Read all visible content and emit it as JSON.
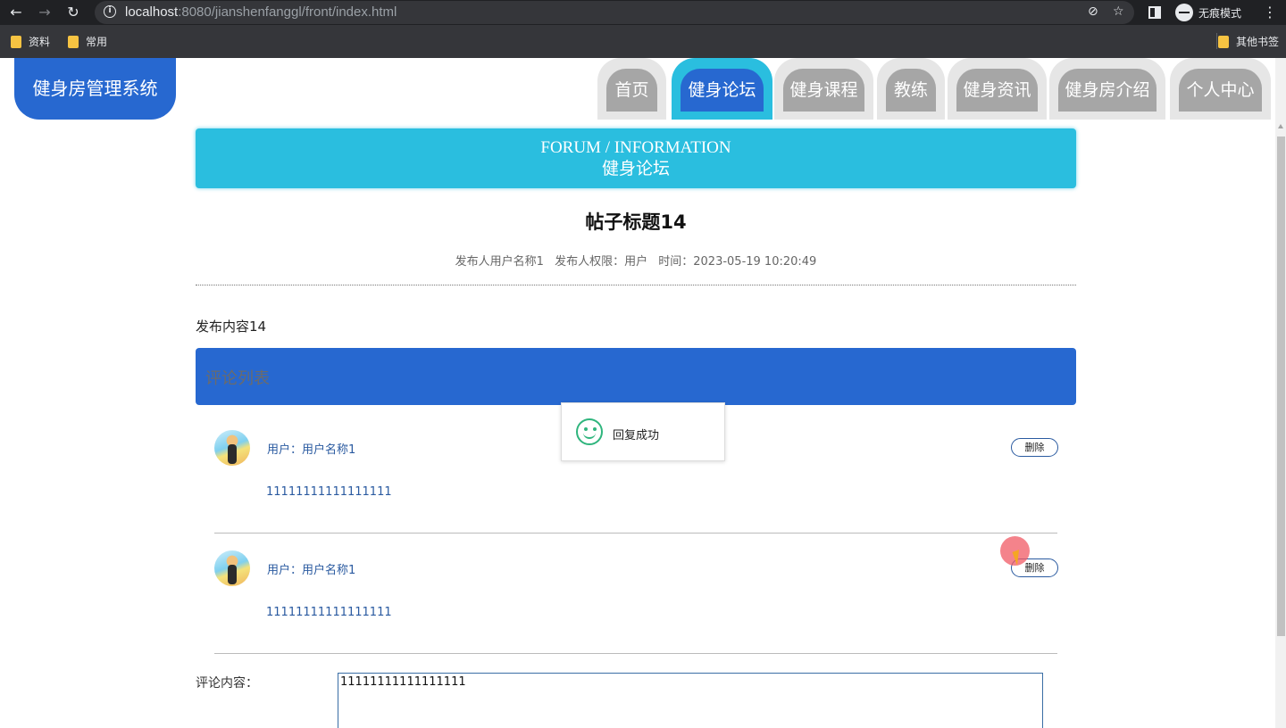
{
  "browser": {
    "url_host": "localhost",
    "url_rest": ":8080/jianshenfanggl/front/index.html",
    "incognito_label": "无痕模式",
    "bookmarks": [
      "资料",
      "常用"
    ],
    "other_bookmarks": "其他书签"
  },
  "site": {
    "logo": "健身房管理系统",
    "nav": [
      "首页",
      "健身论坛",
      "健身课程",
      "教练",
      "健身资讯",
      "健身房介绍",
      "个人中心"
    ],
    "active_nav": "健身论坛"
  },
  "banner": {
    "en": "FORUM / INFORMATION",
    "cn": "健身论坛"
  },
  "post": {
    "title": "帖子标题14",
    "author": "发布人用户名称1",
    "role": "发布人权限：用户",
    "time": "时间：2023-05-19 10:20:49",
    "content": "发布内容14"
  },
  "comments": {
    "header": "评论列表",
    "items": [
      {
        "user": "用户：用户名称1",
        "text": "11111111111111111",
        "delete_label": "删除"
      },
      {
        "user": "用户：用户名称1",
        "text": "11111111111111111",
        "delete_label": "删除"
      }
    ]
  },
  "form": {
    "label": "评论内容：",
    "value": "11111111111111111"
  },
  "toast": {
    "message": "回复成功"
  },
  "colors": {
    "primary": "#2768d0",
    "accent": "#2abedf",
    "tab_inactive": "#a6a6a6"
  }
}
